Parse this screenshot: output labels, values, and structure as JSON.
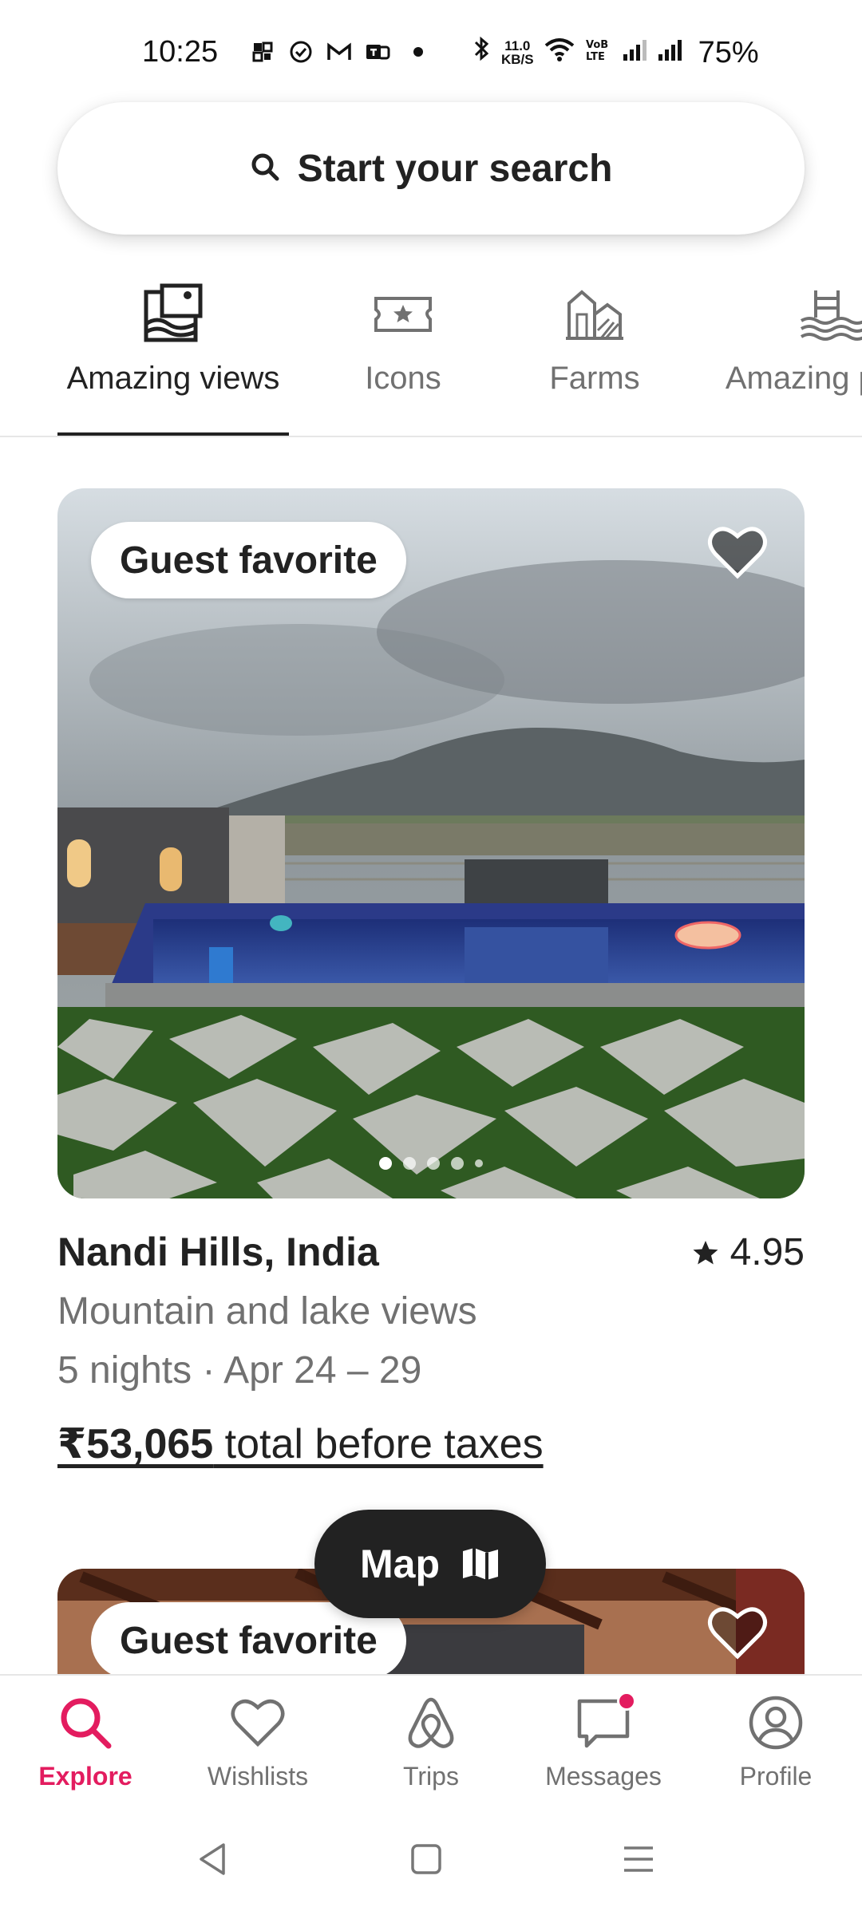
{
  "status_bar": {
    "time": "10:25",
    "net_speed_value": "11.0",
    "net_speed_unit": "KB/S",
    "network_label": "VoB LTE",
    "battery": "75%"
  },
  "search": {
    "label": "Start your search"
  },
  "categories": [
    {
      "label": "Amazing views",
      "icon": "mountain-view-icon",
      "active": true
    },
    {
      "label": "Icons",
      "icon": "ticket-star-icon",
      "active": false
    },
    {
      "label": "Farms",
      "icon": "farm-barn-icon",
      "active": false
    },
    {
      "label": "Amazing pools",
      "icon": "pool-icon",
      "active": false
    }
  ],
  "listing": {
    "badge": "Guest favorite",
    "title": "Nandi Hills, India",
    "rating": "4.95",
    "subtitle": "Mountain and lake views",
    "dates": "5 nights · Apr 24 – 29",
    "price_amount": "₹53,065",
    "price_suffix": " total before taxes",
    "photo_count": 5,
    "photo_active_index": 0
  },
  "listing2": {
    "badge": "Guest favorite"
  },
  "map_button": {
    "label": "Map"
  },
  "bottom_nav": [
    {
      "label": "Explore",
      "icon": "search-icon",
      "active": true
    },
    {
      "label": "Wishlists",
      "icon": "heart-icon",
      "active": false
    },
    {
      "label": "Trips",
      "icon": "airbnb-logo-icon",
      "active": false
    },
    {
      "label": "Messages",
      "icon": "message-icon",
      "active": false,
      "notification": true
    },
    {
      "label": "Profile",
      "icon": "profile-icon",
      "active": false
    }
  ],
  "colors": {
    "accent": "#E31C5F",
    "text": "#222222",
    "muted": "#717171"
  }
}
